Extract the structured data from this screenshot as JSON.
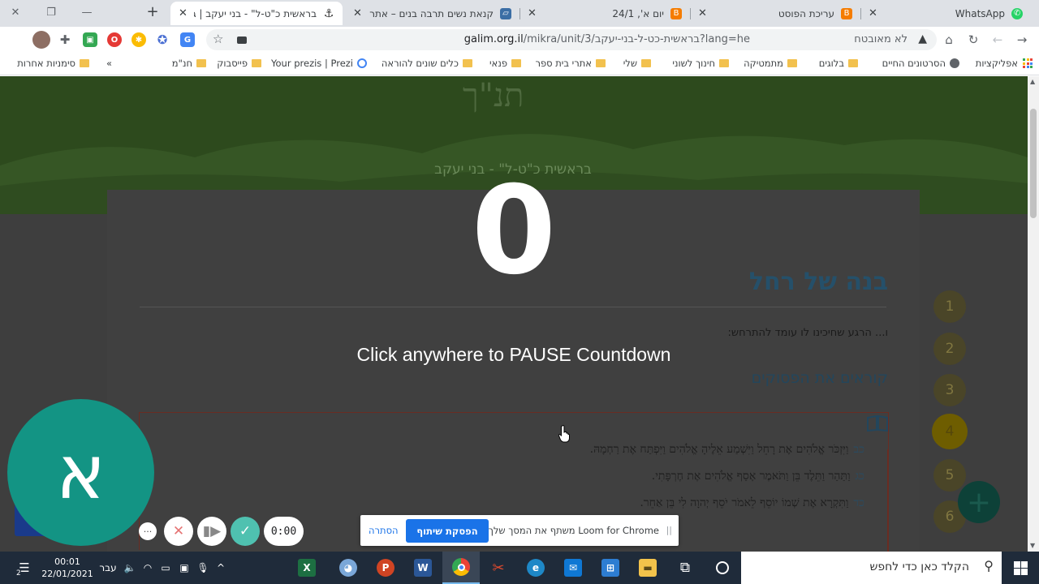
{
  "tabs": [
    {
      "title": "WhatsApp",
      "favicon": "whatsapp-icon",
      "color": "#25d366"
    },
    {
      "title": "עריכת הפוסט",
      "favicon": "blogger-icon",
      "color": "#f57c00"
    },
    {
      "title": "יום א', 24/1",
      "favicon": "blogger-icon",
      "color": "#f57c00"
    },
    {
      "title": "קנאת נשים תרבה בנים – אתר",
      "favicon": "site-icon",
      "color": "#3b6ea5"
    },
    {
      "title": "בראשית כ\"ט-ל\" - בני יעקב | גל",
      "favicon": "galim-icon",
      "color": "#333333"
    }
  ],
  "toolbar": {
    "security_label": "לא מאובטח",
    "url_host": "galim.org.il",
    "url_path": "/mikra/unit/3/בראשית-כט-ל-בני-יעקב?lang=he"
  },
  "bookmarks": [
    {
      "label": "אפליקציות",
      "type": "apps"
    },
    {
      "label": "הסרטונים החיים",
      "type": "globe"
    },
    {
      "label": "בלוגים",
      "type": "folder"
    },
    {
      "label": "מתמטיקה",
      "type": "folder"
    },
    {
      "label": "חינוך לשוני",
      "type": "folder"
    },
    {
      "label": "שלי",
      "type": "folder"
    },
    {
      "label": "אתרי בית ספר",
      "type": "folder"
    },
    {
      "label": "פנאי",
      "type": "folder"
    },
    {
      "label": "כלים שונים להוראה",
      "type": "folder"
    },
    {
      "label": "Your prezis | Prezi",
      "type": "ring"
    },
    {
      "label": "פייסבוק",
      "type": "folder"
    },
    {
      "label": "חנ\"מ",
      "type": "folder"
    },
    {
      "label": "»",
      "type": "more"
    },
    {
      "label": "סימניות אחרות",
      "type": "folder"
    }
  ],
  "page": {
    "hero_title": "תנ\"ך",
    "hero_subtitle": "בראשית כ\"ט-ל\" - בני יעקב",
    "heading": "בנה של רחל",
    "intro": "ו... הרגע שחיכינו לו עומד להתרחש:",
    "subheading": "קוראים את הפסוקים",
    "verses": [
      {
        "num": "כב",
        "text": "וַיִּזְכֹּר אֱלֹהִים אֶת רָחֵל וַיִּשְׁמַע אֵלֶיהָ אֱלֹהִים וַיִּפְתַּח אֶת רַחְמָהּ."
      },
      {
        "num": "כג",
        "text": "וַתַּהַר וַתֵּלֶד בֵּן וַתֹּאמֶר אָסַף אֱלֹהִים אֶת חֶרְפָּתִי."
      },
      {
        "num": "כד",
        "text": "וַתִּקְרָא אֶת שְׁמוֹ יוֹסֵף לֵאמֹר יֹסֵף יְהוָה לִי בֵּן אַחֵר."
      }
    ],
    "steps": [
      "1",
      "2",
      "3",
      "4",
      "5",
      "6"
    ],
    "current_step": "4",
    "fab_label": "+"
  },
  "recording": {
    "countdown": "0",
    "pause_message": "Click anywhere to PAUSE Countdown",
    "avatar_letter": "א",
    "timer": "0:00",
    "more_label": "···",
    "share_message": "Loom for Chrome משתף את המסך שלך.",
    "stop_label": "הפסקת שיתוף",
    "hide_label": "הסתרה"
  },
  "taskbar": {
    "search_placeholder": "הקלד כאן כדי לחפש",
    "time": "00:01",
    "date": "22/01/2021",
    "language": "עבר",
    "notification_count": "2"
  }
}
